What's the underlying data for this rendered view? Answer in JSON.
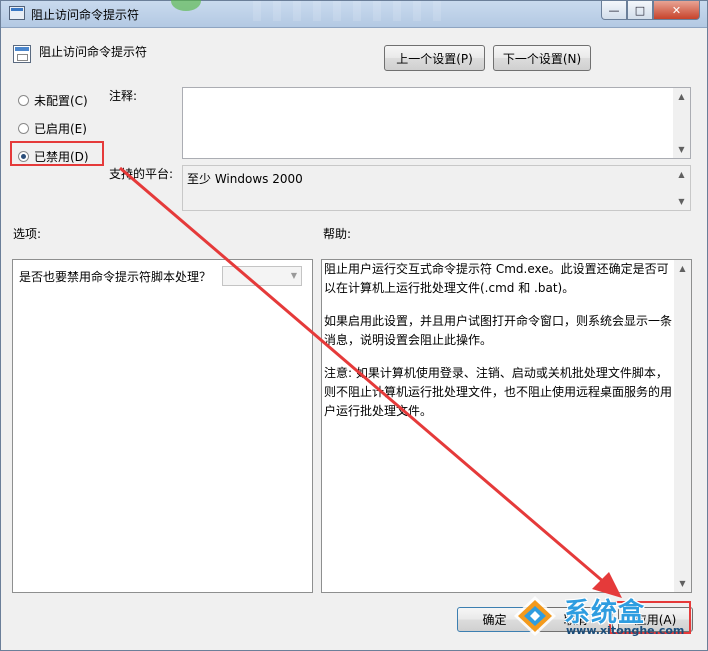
{
  "window": {
    "title": "阻止访问命令提示符",
    "controls": {
      "minimize": "—",
      "maximize": "□",
      "close": "✕"
    }
  },
  "header": {
    "policy_title": "阻止访问命令提示符",
    "prev_button": "上一个设置(P)",
    "next_button": "下一个设置(N)"
  },
  "state_options": [
    {
      "label": "未配置(C)",
      "selected": false
    },
    {
      "label": "已启用(E)",
      "selected": false
    },
    {
      "label": "已禁用(D)",
      "selected": true
    }
  ],
  "comment": {
    "label": "注释:",
    "value": ""
  },
  "platform": {
    "label": "支持的平台:",
    "value": "至少 Windows 2000"
  },
  "options": {
    "label": "选项:",
    "question": "是否也要禁用命令提示符脚本处理？",
    "dropdown_value": ""
  },
  "help": {
    "label": "帮助:",
    "paragraphs": [
      "阻止用户运行交互式命令提示符 Cmd.exe。此设置还确定是否可以在计算机上运行批处理文件(.cmd 和 .bat)。",
      "如果启用此设置，并且用户试图打开命令窗口，则系统会显示一条消息，说明设置会阻止此操作。",
      "注意: 如果计算机使用登录、注销、启动或关机批处理文件脚本，则不阻止计算机运行批处理文件，也不阻止使用远程桌面服务的用户运行批处理文件。"
    ]
  },
  "footer": {
    "ok_button": "确定",
    "cancel_button": "取消",
    "apply_button": "应用(A)"
  },
  "watermark": {
    "brand": "系统盒",
    "url": "www.xitonghe.com"
  },
  "annotation_color": "#e53a3a"
}
